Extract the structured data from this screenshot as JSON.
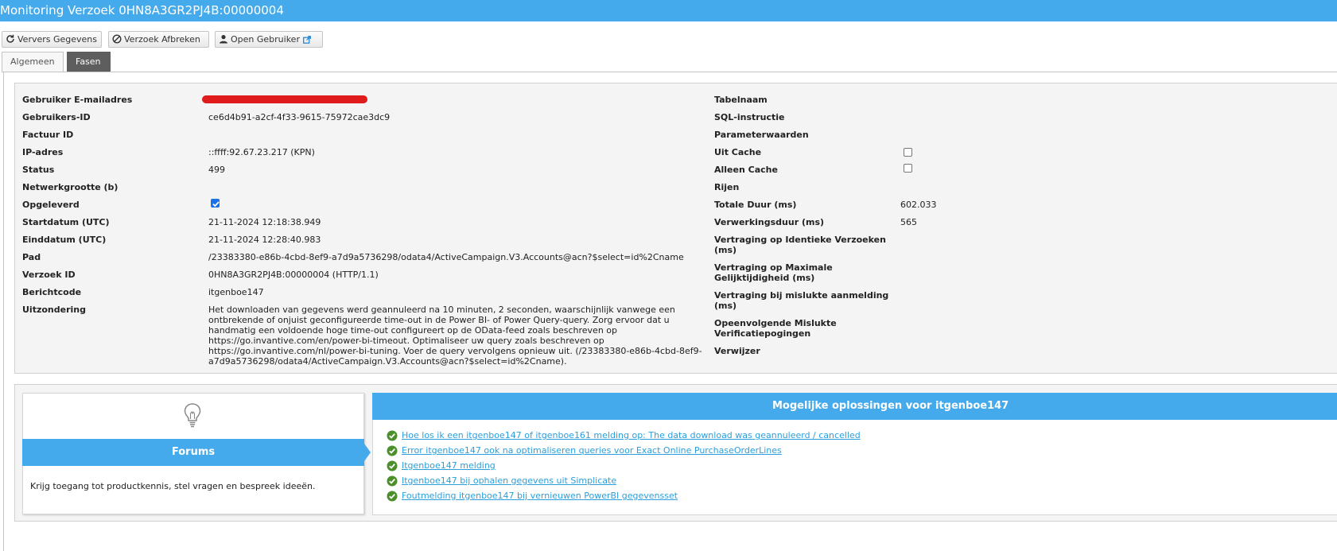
{
  "window": {
    "title": "Monitoring Verzoek 0HN8A3GR2PJ4B:00000004"
  },
  "toolbar": {
    "refresh_label": "Ververs Gegevens",
    "abort_label": "Verzoek Afbreken",
    "open_user_label": "Open Gebruiker"
  },
  "tabs": [
    {
      "label": "Algemeen"
    },
    {
      "label": "Fasen"
    }
  ],
  "details": {
    "left": [
      {
        "label": "Gebruiker E-mailadres",
        "value": ""
      },
      {
        "label": "Gebruikers-ID",
        "value": "ce6d4b91-a2cf-4f33-9615-75972cae3dc9"
      },
      {
        "label": "Factuur ID",
        "value": ""
      },
      {
        "label": "IP-adres",
        "value": "::ffff:92.67.23.217 (KPN)"
      },
      {
        "label": "Status",
        "value": "499"
      },
      {
        "label": "Netwerkgrootte (b)",
        "value": ""
      },
      {
        "label": "Opgeleverd",
        "checked": true
      },
      {
        "label": "Startdatum (UTC)",
        "value": "21-11-2024 12:18:38.949"
      },
      {
        "label": "Einddatum (UTC)",
        "value": "21-11-2024 12:28:40.983"
      },
      {
        "label": "Pad",
        "value": "/23383380-e86b-4cbd-8ef9-a7d9a5736298/odata4/ActiveCampaign.V3.Accounts@acn?$select=id%2Cname"
      },
      {
        "label": "Verzoek ID",
        "value": "0HN8A3GR2PJ4B:00000004 (HTTP/1.1)"
      },
      {
        "label": "Berichtcode",
        "value": "itgenboe147"
      },
      {
        "label": "Uitzondering",
        "value_lines": [
          "Het downloaden van gegevens werd geannuleerd na 10 minuten, 2 seconden, waarschijnlijk vanwege een",
          "ontbrekende of onjuist geconfigureerde time-out in de Power BI- of Power Query-query. Zorg ervoor dat u",
          "handmatig een voldoende hoge time-out configureert op de OData-feed zoals beschreven op",
          "https://go.invantive.com/en/power-bi-timeout. Optimaliseer uw query zoals beschreven op",
          "https://go.invantive.com/nl/power-bi-tuning. Voer de query vervolgens opnieuw uit. (/23383380-e86b-4cbd-8ef9-",
          "a7d9a5736298/odata4/ActiveCampaign.V3.Accounts@acn?$select=id%2Cname)."
        ]
      }
    ],
    "right": [
      {
        "label": "Tabelnaam",
        "value": ""
      },
      {
        "label": "SQL-instructie",
        "value": ""
      },
      {
        "label": "Parameterwaarden",
        "value": ""
      },
      {
        "label": "Uit Cache",
        "checked": false
      },
      {
        "label": "Alleen Cache",
        "checked": false
      },
      {
        "label": "Rijen",
        "value": ""
      },
      {
        "label": "Totale Duur (ms)",
        "value": "602.033"
      },
      {
        "label": "Verwerkingsduur (ms)",
        "value": "565"
      },
      {
        "label_lines": [
          "Vertraging op Identieke Verzoeken",
          "(ms)"
        ]
      },
      {
        "label_lines": [
          "Vertraging op Maximale",
          "Gelijktijdigheid (ms)"
        ]
      },
      {
        "label_lines": [
          "Vertraging bij mislukte aanmelding",
          "(ms)"
        ]
      },
      {
        "label_lines": [
          "Opeenvolgende Mislukte",
          "Verificatiepogingen"
        ]
      },
      {
        "label": "Verwijzer",
        "value": ""
      }
    ]
  },
  "forum": {
    "title": "Forums",
    "description": "Krijg toegang tot productkennis, stel vragen en bespreek ideeën.",
    "icon": "lightbulb-icon"
  },
  "solutions": {
    "title": "Mogelijke oplossingen voor itgenboe147",
    "links": [
      "Hoe los ik een itgenboe147 of itgenboe161 melding op: The data download was geannuleerd / cancelled",
      "Error itgenboe147 ook na optimaliseren queries voor Exact Online PurchaseOrderLines",
      "Itgenboe147 melding",
      "Itgenboe147 bij ophalen gegevens uit Simplicate",
      "Foutmelding itgenboe147 bij vernieuwen PowerBI gegevensset"
    ]
  },
  "colors": {
    "accent": "#45aaeb",
    "link": "#2a9fdc",
    "check": "#4a8f2a",
    "redaction": "#e01b1b"
  }
}
